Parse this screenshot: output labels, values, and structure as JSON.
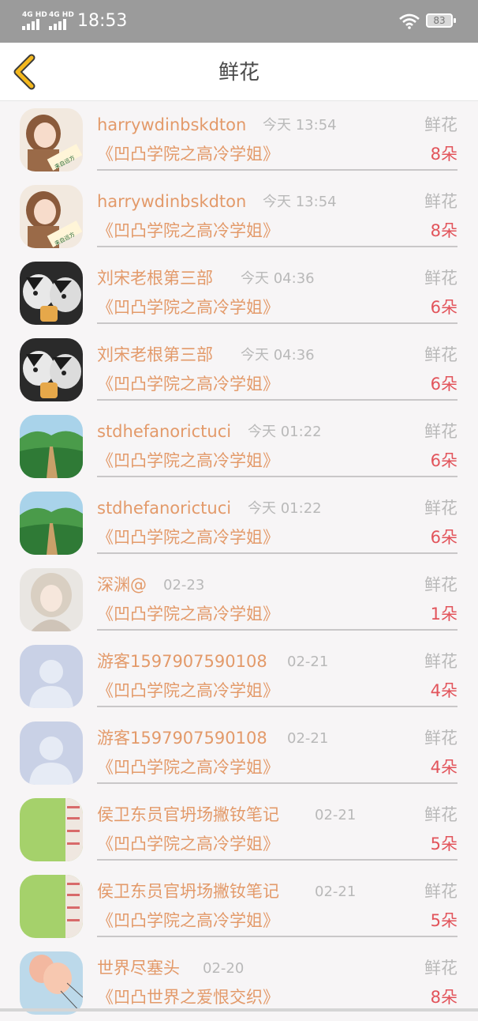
{
  "status_bar": {
    "network1": "4G HD",
    "network2": "4G HD",
    "time": "18:53",
    "battery": "83"
  },
  "header": {
    "title": "鲜花",
    "back_icon": "chevron-left-icon"
  },
  "colors": {
    "accent_orange": "#e39a6a",
    "count_red": "#e2545b",
    "muted_gray": "#b9b9b9",
    "back_yellow": "#f4b81d"
  },
  "records": [
    {
      "name": "harrywdinbskdton",
      "date": "今天 13:54",
      "gift": "鲜花",
      "book": "《凹凸学院之高冷学姐》",
      "count": "8朵",
      "avatar": "anime-girl"
    },
    {
      "name": "harrywdinbskdton",
      "date": "今天 13:54",
      "gift": "鲜花",
      "book": "《凹凸学院之高冷学姐》",
      "count": "8朵",
      "avatar": "anime-girl"
    },
    {
      "name": "刘宋老根第三部",
      "date": "今天 04:36",
      "gift": "鲜花",
      "book": "《凹凸学院之高冷学姐》",
      "count": "6朵",
      "avatar": "husky"
    },
    {
      "name": "刘宋老根第三部",
      "date": "今天 04:36",
      "gift": "鲜花",
      "book": "《凹凸学院之高冷学姐》",
      "count": "6朵",
      "avatar": "husky"
    },
    {
      "name": "stdhefanorictuci",
      "date": "今天 01:22",
      "gift": "鲜花",
      "book": "《凹凸学院之高冷学姐》",
      "count": "6朵",
      "avatar": "landscape"
    },
    {
      "name": "stdhefanorictuci",
      "date": "今天 01:22",
      "gift": "鲜花",
      "book": "《凹凸学院之高冷学姐》",
      "count": "6朵",
      "avatar": "landscape"
    },
    {
      "name": "深渊@",
      "date": "02-23",
      "gift": "鲜花",
      "book": "《凹凸学院之高冷学姐》",
      "count": "1朵",
      "avatar": "portrait"
    },
    {
      "name": "游客1597907590108",
      "date": "02-21",
      "gift": "鲜花",
      "book": "《凹凸学院之高冷学姐》",
      "count": "4朵",
      "avatar": "default-user"
    },
    {
      "name": "游客1597907590108",
      "date": "02-21",
      "gift": "鲜花",
      "book": "《凹凸学院之高冷学姐》",
      "count": "4朵",
      "avatar": "default-user"
    },
    {
      "name": "侯卫东员官坍场撇钕笔记",
      "date": "02-21",
      "gift": "鲜花",
      "book": "《凹凸学院之高冷学姐》",
      "count": "5朵",
      "avatar": "green-note"
    },
    {
      "name": "侯卫东员官坍场撇钕笔记",
      "date": "02-21",
      "gift": "鲜花",
      "book": "《凹凸学院之高冷学姐》",
      "count": "5朵",
      "avatar": "green-note"
    },
    {
      "name": "世界尽塞头",
      "date": "02-20",
      "gift": "鲜花",
      "book": "《凹凸世界之爱恨交织》",
      "count": "8朵",
      "avatar": "balloon"
    }
  ]
}
